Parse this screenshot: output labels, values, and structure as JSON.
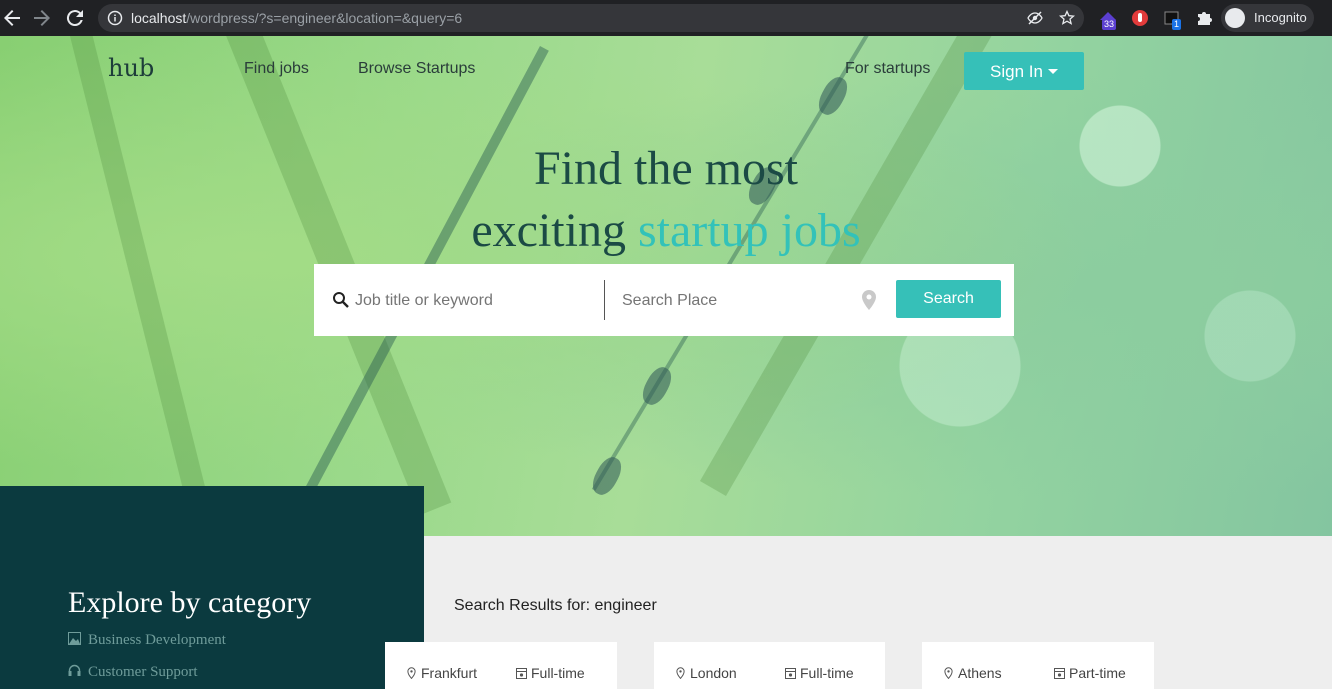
{
  "browser": {
    "url_host": "localhost",
    "url_path": "/wordpress/?s=engineer&location=&query=6",
    "ext_badge_1": "33",
    "ext_badge_2": "1",
    "profile_label": "Incognito"
  },
  "site": {
    "brand": "hub",
    "nav": {
      "find_jobs": "Find jobs",
      "browse_startups": "Browse Startups",
      "for_startups": "For startups",
      "sign_in": "Sign In"
    },
    "hero": {
      "line1": "Find the most",
      "line2_plain": "exciting",
      "line2_accent": "startup jobs"
    },
    "search": {
      "keyword_placeholder": "Job title or keyword",
      "place_placeholder": "Search Place",
      "button": "Search"
    }
  },
  "categories": {
    "title": "Explore by category",
    "items": [
      {
        "label": "Business Development",
        "icon": "image-icon"
      },
      {
        "label": "Customer Support",
        "icon": "headset-icon"
      }
    ]
  },
  "results": {
    "title": "Search Results for: engineer",
    "cards": [
      {
        "location": "Frankfurt",
        "type": "Full-time"
      },
      {
        "location": "London",
        "type": "Full-time"
      },
      {
        "location": "Athens",
        "type": "Part-time"
      }
    ]
  },
  "colors": {
    "accent": "#36c0b8",
    "panel": "#0b3a3f",
    "chrome": "#202124"
  }
}
